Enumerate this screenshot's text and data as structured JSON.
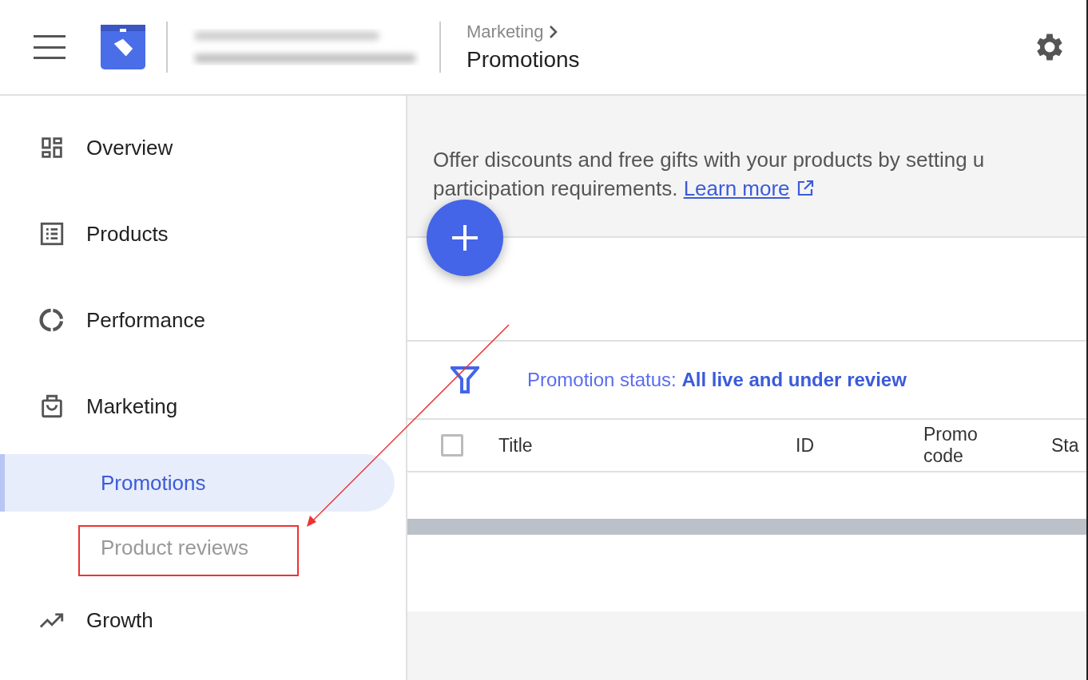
{
  "header": {
    "breadcrumb": "Marketing",
    "title": "Promotions"
  },
  "sidebar": {
    "items": [
      {
        "label": "Overview",
        "selected": false
      },
      {
        "label": "Products",
        "selected": false
      },
      {
        "label": "Performance",
        "selected": false
      },
      {
        "label": "Marketing",
        "selected": false,
        "children": [
          {
            "label": "Promotions",
            "selected": true,
            "disabled": false
          },
          {
            "label": "Product reviews",
            "selected": false,
            "disabled": true
          }
        ]
      },
      {
        "label": "Growth",
        "selected": false
      }
    ]
  },
  "intro": {
    "lines": [
      "Offer discounts and free gifts with your products by setting u",
      "participation requirements."
    ],
    "link": "Learn more"
  },
  "filter": {
    "text": "Promotion status: **All live and under review**"
  },
  "table": {
    "select_all_checked": false,
    "columns": [
      "Title",
      "ID",
      "Promo code",
      "Sta"
    ]
  },
  "annotation": {
    "visible": true
  }
}
